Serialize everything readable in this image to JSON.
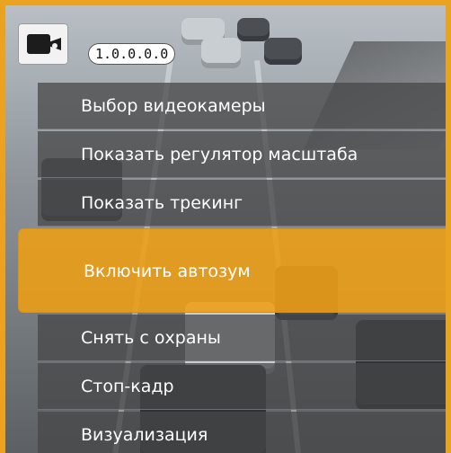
{
  "overlay": {
    "camera_id": "1.0.0.0.0",
    "camera_icon": "video-camera-icon",
    "border_color": "#e9a320"
  },
  "context_menu": {
    "items": [
      {
        "label": "Выбор видеокамеры",
        "active": false
      },
      {
        "label": "Показать регулятор масштаба",
        "active": false
      },
      {
        "label": "Показать трекинг",
        "active": false
      },
      {
        "label": "Включить автозум",
        "active": true
      },
      {
        "label": "Снять с охраны",
        "active": false
      },
      {
        "label": "Стоп-кадр",
        "active": false
      },
      {
        "label": "Визуализация",
        "active": false
      }
    ],
    "colors": {
      "item_background": "#464646",
      "active_background": "#ee9e14"
    }
  }
}
